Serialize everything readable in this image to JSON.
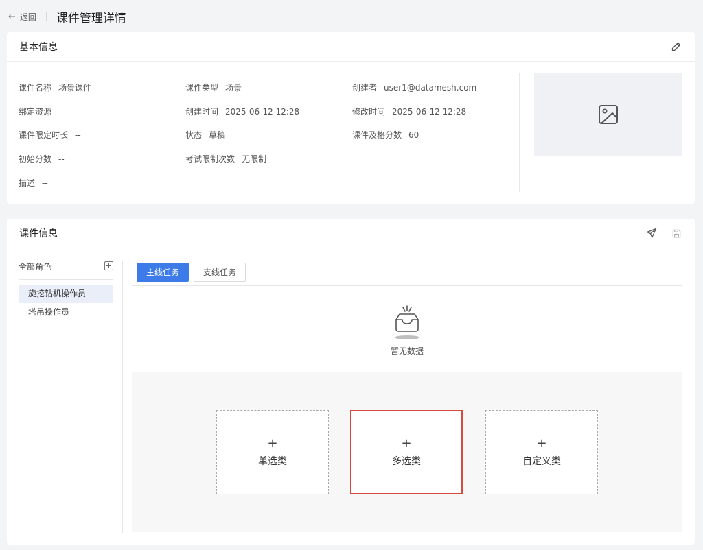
{
  "header": {
    "back_label": "返回",
    "title": "课件管理详情"
  },
  "basic": {
    "title": "基本信息",
    "fields": {
      "name": {
        "label": "课件名称",
        "value": "场景课件"
      },
      "type": {
        "label": "课件类型",
        "value": "场景"
      },
      "creator": {
        "label": "创建者",
        "value": "user1@datamesh.com"
      },
      "resource": {
        "label": "绑定资源",
        "value": "--"
      },
      "created": {
        "label": "创建时间",
        "value": "2025-06-12 12:28"
      },
      "modified": {
        "label": "修改时间",
        "value": "2025-06-12 12:28"
      },
      "duration": {
        "label": "课件限定时长",
        "value": "--"
      },
      "status": {
        "label": "状态",
        "value": "草稿"
      },
      "pass_score": {
        "label": "课件及格分数",
        "value": "60"
      },
      "init_score": {
        "label": "初始分数",
        "value": "--"
      },
      "exam_limit": {
        "label": "考试限制次数",
        "value": "无限制"
      },
      "desc": {
        "label": "描述",
        "value": "--"
      }
    }
  },
  "course": {
    "title": "课件信息",
    "roles_title": "全部角色",
    "roles": [
      "旋挖钻机操作员",
      "塔吊操作员"
    ],
    "tabs": [
      "主线任务",
      "支线任务"
    ],
    "empty_text": "暂无数据",
    "types": [
      "单选类",
      "多选类",
      "自定义类"
    ],
    "plus": "+"
  },
  "colors": {
    "accent": "#3c7be8",
    "selected_border": "#d64b3e",
    "active_role_bg": "#e9eef9"
  }
}
